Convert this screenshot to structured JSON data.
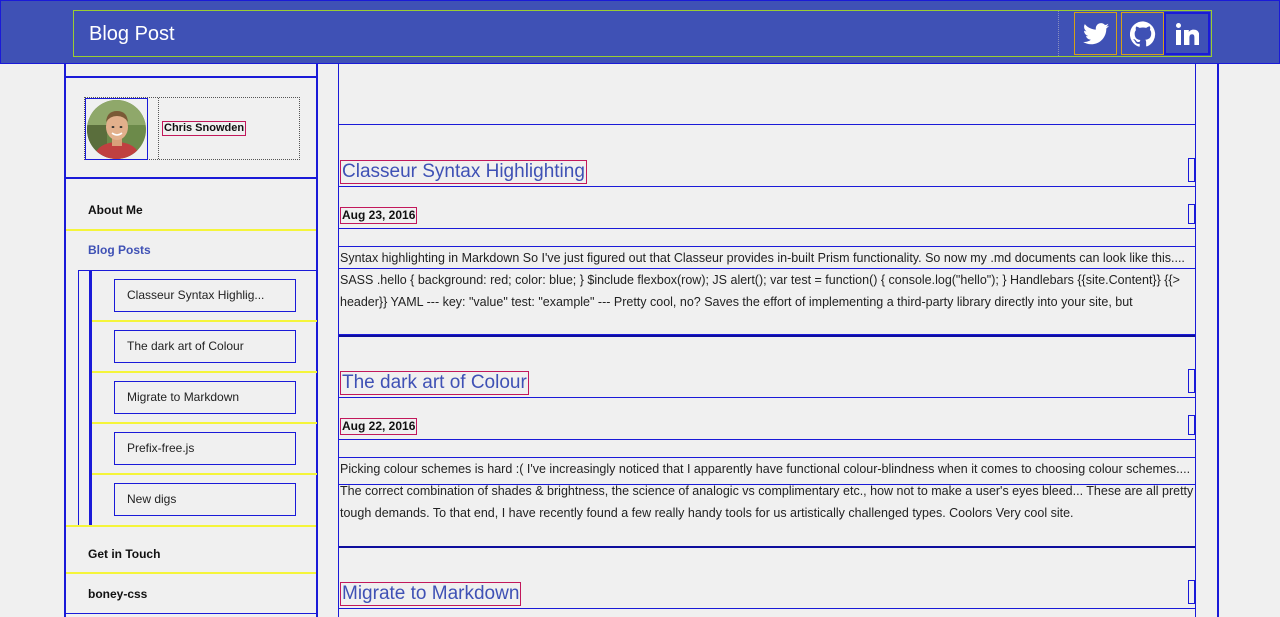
{
  "header": {
    "title": "Blog Post",
    "social": [
      {
        "name": "twitter",
        "icon": "twitter-icon"
      },
      {
        "name": "github",
        "icon": "github-icon"
      },
      {
        "name": "linkedin",
        "icon": "linkedin-icon"
      }
    ]
  },
  "colors": {
    "primary": "#3f51b5",
    "outline_blue": "#1a1ad8",
    "outline_magenta": "#c2185b",
    "outline_yellow": "#f5f53a",
    "background": "#f0f0f0"
  },
  "sidebar": {
    "profile": {
      "name": "Chris Snowden"
    },
    "nav": [
      {
        "label": "About Me"
      },
      {
        "label": "Blog Posts"
      },
      {
        "label": "Get in Touch"
      },
      {
        "label": "boney-css"
      }
    ],
    "sub_items": [
      {
        "label": "Classeur Syntax Highlig..."
      },
      {
        "label": "The dark art of Colour"
      },
      {
        "label": "Migrate to Markdown"
      },
      {
        "label": "Prefix-free.js"
      },
      {
        "label": "New digs"
      }
    ]
  },
  "posts": [
    {
      "title": "Classeur Syntax Highlighting",
      "date": "Aug 23, 2016",
      "excerpt": "Syntax highlighting in Markdown So I've just figured out that Classeur provides in-built Prism functionality. So now my .md documents can look like this.... SASS .hello { background: red; color: blue; } $include flexbox(row); JS alert(); var test = function() { console.log(\"hello\"); } Handlebars {{site.Content}} {{> header}} YAML --- key: \"value\" test: \"example\" --- Pretty cool, no? Saves the effort of implementing a third-party library directly into your site, but"
    },
    {
      "title": "The dark art of Colour",
      "date": "Aug 22, 2016",
      "excerpt": "Picking colour schemes is hard :( I've increasingly noticed that I apparently have functional colour-blindness when it comes to choosing colour schemes.... The correct combination of shades & brightness, the science of analogic vs complimentary etc., how not to make a user's eyes bleed...  These are all pretty tough demands. To that end, I have recently found a few really handy tools for us artistically challenged types. Coolors Very cool site."
    },
    {
      "title": "Migrate to Markdown"
    }
  ]
}
